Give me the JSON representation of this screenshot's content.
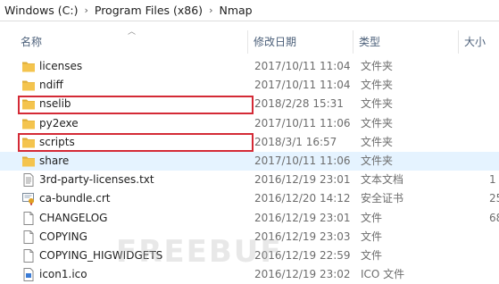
{
  "breadcrumb": {
    "items": [
      "Windows (C:)",
      "Program Files (x86)",
      "Nmap"
    ],
    "separator": "›"
  },
  "columns": {
    "name": "名称",
    "date": "修改日期",
    "type": "类型",
    "size": "大小"
  },
  "files": [
    {
      "name": "licenses",
      "date": "2017/10/11 11:04",
      "type": "文件夹",
      "size": "",
      "icon": "folder-icon"
    },
    {
      "name": "ndiff",
      "date": "2017/10/11 11:04",
      "type": "文件夹",
      "size": "",
      "icon": "folder-icon"
    },
    {
      "name": "nselib",
      "date": "2018/2/28 15:31",
      "type": "文件夹",
      "size": "",
      "icon": "folder-icon"
    },
    {
      "name": "py2exe",
      "date": "2017/10/11 11:06",
      "type": "文件夹",
      "size": "",
      "icon": "folder-icon"
    },
    {
      "name": "scripts",
      "date": "2018/3/1 16:57",
      "type": "文件夹",
      "size": "",
      "icon": "folder-icon"
    },
    {
      "name": "share",
      "date": "2017/10/11 11:06",
      "type": "文件夹",
      "size": "",
      "icon": "folder-icon"
    },
    {
      "name": "3rd-party-licenses.txt",
      "date": "2016/12/19 23:01",
      "type": "文本文档",
      "size": "1",
      "icon": "text-file-icon"
    },
    {
      "name": "ca-bundle.crt",
      "date": "2016/12/20 14:12",
      "type": "安全证书",
      "size": "25",
      "icon": "certificate-icon"
    },
    {
      "name": "CHANGELOG",
      "date": "2016/12/19 23:01",
      "type": "文件",
      "size": "68",
      "icon": "file-icon"
    },
    {
      "name": "COPYING",
      "date": "2016/12/19 23:03",
      "type": "文件",
      "size": "",
      "icon": "file-icon"
    },
    {
      "name": "COPYING_HIGWIDGETS",
      "date": "2016/12/19 22:59",
      "type": "文件",
      "size": "",
      "icon": "file-icon"
    },
    {
      "name": "icon1.ico",
      "date": "2016/12/19 23:02",
      "type": "ICO 文件",
      "size": "",
      "icon": "ico-file-icon"
    }
  ],
  "watermark": "FREEBUF",
  "colors": {
    "highlight": "#d42a36",
    "folder": "#f4c44e",
    "hover": "#e5f3ff"
  }
}
